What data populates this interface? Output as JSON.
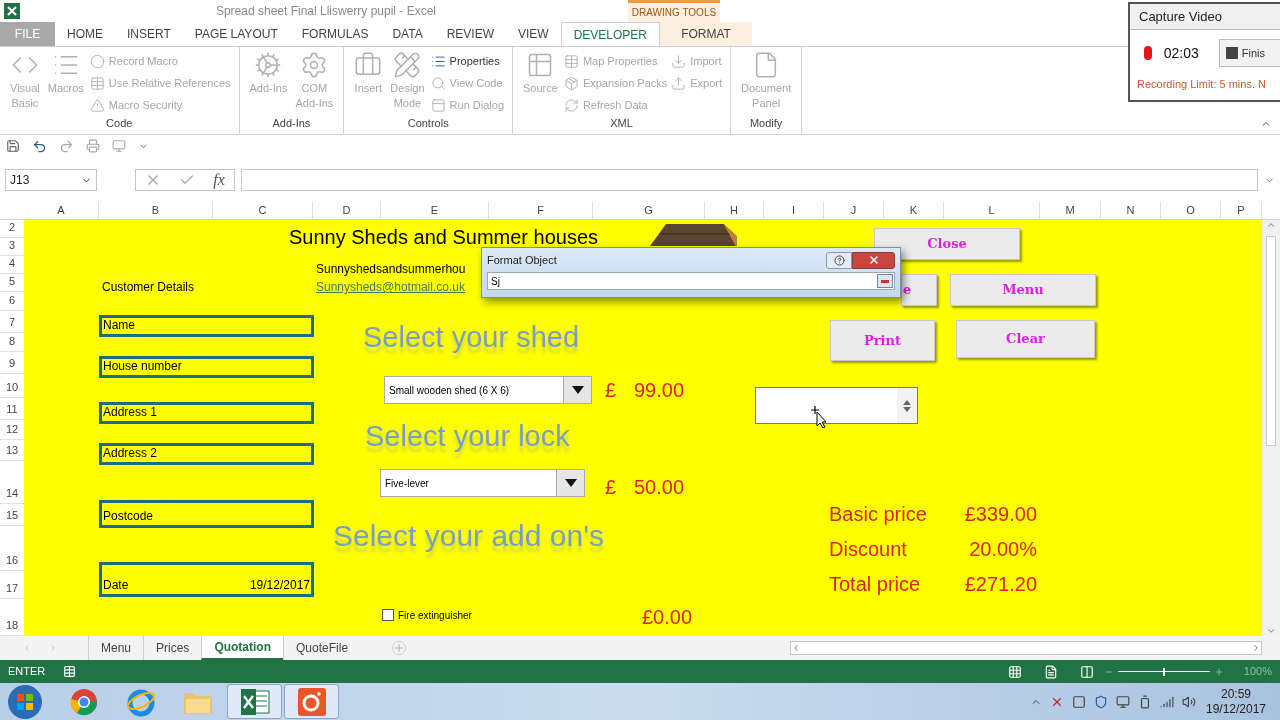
{
  "window": {
    "title": "Spread sheet Final Lliswerry pupil - Excel"
  },
  "contextual_tab_group": {
    "label": "DRAWING TOOLS"
  },
  "ribbon_tabs": [
    {
      "label": "FILE",
      "kind": "file",
      "selected": false
    },
    {
      "label": "HOME",
      "kind": "normal",
      "selected": false
    },
    {
      "label": "INSERT",
      "kind": "normal",
      "selected": false
    },
    {
      "label": "PAGE LAYOUT",
      "kind": "normal",
      "selected": false
    },
    {
      "label": "FORMULAS",
      "kind": "normal",
      "selected": false
    },
    {
      "label": "DATA",
      "kind": "normal",
      "selected": false
    },
    {
      "label": "REVIEW",
      "kind": "normal",
      "selected": false
    },
    {
      "label": "VIEW",
      "kind": "normal",
      "selected": false
    },
    {
      "label": "DEVELOPER",
      "kind": "normal",
      "selected": true
    },
    {
      "label": "FORMAT",
      "kind": "contextual",
      "selected": false
    }
  ],
  "ribbon": {
    "groups": [
      {
        "label": "Code",
        "items": [
          {
            "label": "Visual Basic",
            "kind": "large",
            "disabled": true
          },
          {
            "label": "Macros",
            "kind": "large",
            "disabled": true
          },
          {
            "label": "Record Macro",
            "kind": "small",
            "disabled": true
          },
          {
            "label": "Use Relative References",
            "kind": "small",
            "disabled": true
          },
          {
            "label": "Macro Security",
            "kind": "small",
            "disabled": true
          }
        ]
      },
      {
        "label": "Add-Ins",
        "items": [
          {
            "label": "Add-Ins",
            "kind": "large",
            "disabled": true
          },
          {
            "label": "COM Add-Ins",
            "kind": "large",
            "disabled": true
          }
        ]
      },
      {
        "label": "Controls",
        "items": [
          {
            "label": "Insert",
            "kind": "large",
            "disabled": true
          },
          {
            "label": "Design Mode",
            "kind": "large",
            "disabled": true
          },
          {
            "label": "Properties",
            "kind": "small",
            "disabled": false
          },
          {
            "label": "View Code",
            "kind": "small",
            "disabled": true
          },
          {
            "label": "Run Dialog",
            "kind": "small",
            "disabled": true
          }
        ]
      },
      {
        "label": "XML",
        "items": [
          {
            "label": "Source",
            "kind": "large",
            "disabled": true
          },
          {
            "label": "Map Properties",
            "kind": "small",
            "disabled": true
          },
          {
            "label": "Expansion Packs",
            "kind": "small",
            "disabled": true
          },
          {
            "label": "Refresh Data",
            "kind": "small",
            "disabled": true
          },
          {
            "label": "Import",
            "kind": "small",
            "disabled": true
          },
          {
            "label": "Export",
            "kind": "small",
            "disabled": true
          }
        ]
      },
      {
        "label": "Modify",
        "items": [
          {
            "label": "Document Panel",
            "kind": "large",
            "disabled": true
          }
        ]
      }
    ]
  },
  "name_box": {
    "value": "J13"
  },
  "formula_bar": {
    "function_label": "fx"
  },
  "columns": [
    "A",
    "B",
    "C",
    "D",
    "E",
    "F",
    "G",
    "H",
    "I",
    "J",
    "K",
    "L",
    "M",
    "N",
    "O",
    "P"
  ],
  "rows": [
    "2",
    "3",
    "4",
    "5",
    "6",
    "7",
    "8",
    "9",
    "10",
    "11",
    "12",
    "13",
    "14",
    "15",
    "16",
    "17",
    "18"
  ],
  "sheet": {
    "title": "Sunny Sheds and Summer houses",
    "website": "Sunnyshedsandsummerhou",
    "email": "Sunnysheds@hotmail.co.uk",
    "customer_heading": "Customer Details",
    "fields": [
      {
        "label": "Name"
      },
      {
        "label": "House number"
      },
      {
        "label": "Address 1"
      },
      {
        "label": "Address 2"
      },
      {
        "label": "Postcode"
      },
      {
        "label": "Date",
        "value": "19/12/2017"
      }
    ],
    "selectors": [
      {
        "heading": "Select your shed",
        "choice": "Small wooden shed (6 X 6)",
        "symbol": "£",
        "amount": "99.00"
      },
      {
        "heading": "Select your lock",
        "choice": "Five-lever",
        "symbol": "£",
        "amount": "50.00"
      }
    ],
    "addons": {
      "heading": "Select your add on's",
      "items": [
        {
          "label": "Fire extinguisher",
          "checked": false,
          "price": "£0.00"
        }
      ]
    },
    "buttons": [
      {
        "label": "Close"
      },
      {
        "label": "e"
      },
      {
        "label": "Menu"
      },
      {
        "label": "Print"
      },
      {
        "label": "Clear"
      }
    ],
    "totals": [
      {
        "label": "Basic price",
        "value": "£339.00"
      },
      {
        "label": "Discount",
        "value": "20.00%"
      },
      {
        "label": "Total price",
        "value": "£271.20"
      }
    ]
  },
  "dialog": {
    "title": "Format Object",
    "value": "Sj"
  },
  "sheet_tabs": [
    {
      "label": "Menu",
      "selected": false
    },
    {
      "label": "Prices",
      "selected": false
    },
    {
      "label": "Quotation",
      "selected": true
    },
    {
      "label": "QuoteFile",
      "selected": false
    }
  ],
  "status_bar": {
    "mode": "ENTER",
    "zoom": {
      "level": 0.5,
      "reading": "100%"
    }
  },
  "capture_video": {
    "title": "Capture Video",
    "time": "02:03",
    "button": "Finis",
    "note": "Recording Limit: 5 mins. N"
  },
  "taskbar": {
    "apps": [
      {
        "selected": false
      },
      {
        "selected": false
      },
      {
        "selected": false
      },
      {
        "selected": true
      },
      {
        "selected": true
      }
    ],
    "clock": {
      "time": "20:59",
      "date": "19/12/2017"
    }
  }
}
